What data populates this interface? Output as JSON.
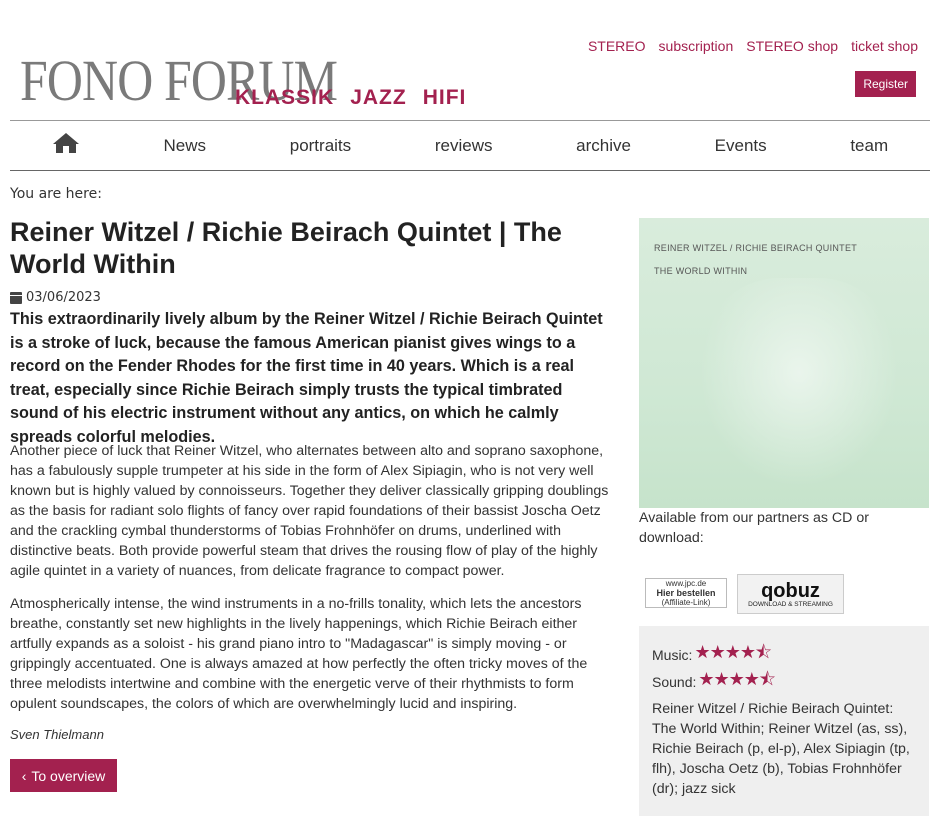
{
  "header": {
    "logo_text": "FONO FORUM",
    "sections": [
      "KLASSIK",
      "JAZZ",
      "HIFI"
    ],
    "top_links": [
      "STEREO",
      "subscription",
      "STEREO shop",
      "ticket shop"
    ],
    "register_label": "Register",
    "accent_color": "#a3214f"
  },
  "nav": {
    "home_icon": "home-icon",
    "items": [
      "News",
      "portraits",
      "reviews",
      "archive",
      "Events",
      "team"
    ]
  },
  "breadcrumb": "You are here:",
  "article": {
    "title": "Reiner Witzel / Richie Beirach Quintet | The World Within",
    "date_icon": "calendar-icon",
    "date": "03/06/2023",
    "lead": "This extraordinarily lively album by the Reiner Witzel / Richie Beirach Quintet is a stroke of luck, because the famous American pianist gives wings to a record on the Fender Rhodes for the first time in 40 years. Which is a real treat, especially since Richie Beirach simply trusts the typical timbrated sound of his electric instrument without any antics, on which he calmly spreads colorful melodies.",
    "paragraphs": [
      "Another piece of luck that Reiner Witzel, who alternates between alto and soprano saxophone, has a fabulously supple trumpeter at his side in the form of Alex Sipiagin, who is not very well known but is highly valued by connoisseurs. Together they deliver classically gripping doublings as the basis for radiant solo flights of fancy over rapid foundations of their bassist Joscha Oetz and the crackling cymbal thunderstorms of Tobias Frohnhöfer on drums, underlined with distinctive beats. Both provide powerful steam that drives the rousing flow of play of the highly agile quintet in a variety of nuances, from delicate fragrance to compact power.",
      "Atmospherically intense, the wind instruments in a no-frills tonality, which lets the ancestors breathe, constantly set new highlights in the lively happenings, which Richie Beirach either artfully expands as a soloist - his grand piano intro to \"Madagascar\" is simply moving - or grippingly accentuated. One is always amazed at how perfectly the often tricky moves of the three melodists intertwine and combine with the energetic verve of their rhythmists to form opulent soundscapes, the colors of which are overwhelmingly lucid and inspiring."
    ],
    "author": "Sven Thielmann",
    "overview_label": "To overview"
  },
  "sidebar": {
    "cover_line1": "REINER WITZEL / RICHIE BEIRACH QUINTET",
    "cover_line2": "THE WORLD WITHIN",
    "available_text": "Available from our partners as CD or download:",
    "jpc_line1": "www.jpc.de",
    "jpc_line2": "Hier bestellen",
    "jpc_line3": "(Affiliate-Link)",
    "qobuz_name": "qobuz",
    "qobuz_sub": "DOWNLOAD & STREAMING",
    "music_label": "Music:",
    "music_rating": 4.5,
    "sound_label": "Sound:",
    "sound_rating": 4.5,
    "stars_display": "★★★★⯪",
    "credits": "Reiner Witzel / Richie Beirach Quintet: The World Within; Reiner Witzel (as, ss), Richie Beirach (p, el-p), Alex Sipiagin (tp, flh), Joscha Oetz (b), Tobias Frohnhöfer (dr); jazz sick"
  }
}
